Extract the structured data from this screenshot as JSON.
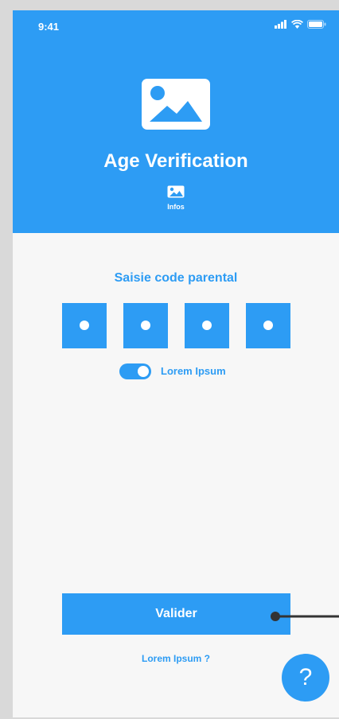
{
  "status_bar": {
    "time": "9:41",
    "icons": [
      "signal-icon",
      "wifi-icon",
      "battery-icon"
    ]
  },
  "header": {
    "image_icon": "image-icon",
    "title": "Age Verification",
    "infos_icon": "image-icon",
    "infos_label": "Infos"
  },
  "main": {
    "section_title": "Saisie code parental",
    "code_digits": [
      "•",
      "•",
      "•",
      "•"
    ],
    "toggle": {
      "label": "Lorem Ipsum",
      "on": true
    },
    "validate_label": "Valider",
    "forgot_link": "Lorem Ipsum ?"
  },
  "help_button": {
    "symbol": "?"
  },
  "colors": {
    "accent": "#2d9cf4",
    "background": "#f7f7f7",
    "white": "#ffffff"
  }
}
